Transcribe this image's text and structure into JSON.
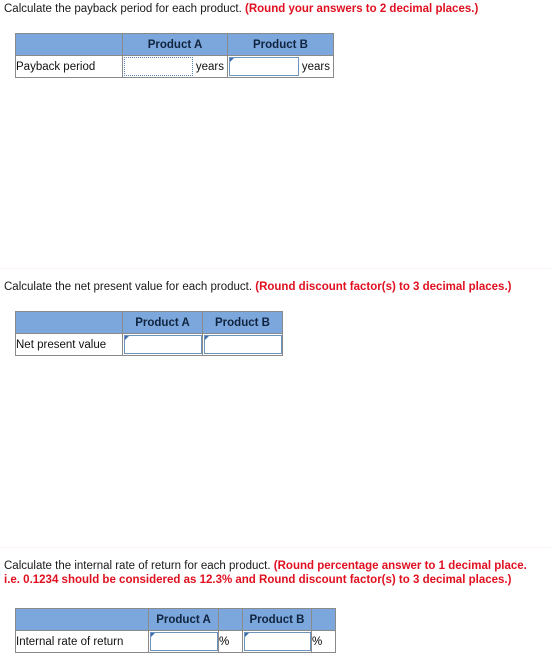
{
  "sections": [
    {
      "id": "payback",
      "question": "Calculate the payback period for each product.",
      "note": "(Round your answers to 2 decimal places.)",
      "note_line2": "",
      "table": {
        "headers": [
          "",
          "Product A",
          "Product B"
        ],
        "row_label": "Payback period",
        "unit": "years",
        "product_a_value": "",
        "product_b_value": "",
        "product_a_focused": true,
        "product_b_focused": false
      }
    },
    {
      "id": "npv",
      "question": "Calculate the net present value for each product.",
      "note": "(Round discount factor(s) to 3 decimal places.)",
      "note_line2": "",
      "table": {
        "headers": [
          "",
          "Product A",
          "Product B"
        ],
        "row_label": "Net present value",
        "unit": "",
        "product_a_value": "",
        "product_b_value": "",
        "product_a_focused": false,
        "product_b_focused": false
      }
    },
    {
      "id": "irr",
      "question": "Calculate the internal rate of return for each product.",
      "note": "(Round percentage answer to 1 decimal place.",
      "note_line2": "i.e. 0.1234 should be considered as 12.3% and Round discount factor(s) to 3 decimal places.)",
      "table": {
        "headers": [
          "",
          "Product A",
          "",
          "Product B",
          ""
        ],
        "row_label": "Internal rate of return",
        "unit": "%",
        "product_a_value": "",
        "product_b_value": "",
        "product_a_focused": false,
        "product_b_focused": false
      }
    }
  ],
  "colors": {
    "header_blue": "#7ba7dc",
    "note_red": "#e01020",
    "border_gray": "#8a8a8a",
    "input_border_blue": "#6d94bd"
  }
}
